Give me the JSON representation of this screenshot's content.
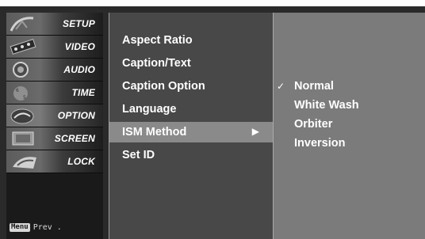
{
  "sidebar": {
    "items": [
      {
        "label": "SETUP",
        "icon": "satellite-dish-icon"
      },
      {
        "label": "VIDEO",
        "icon": "film-reel-icon"
      },
      {
        "label": "AUDIO",
        "icon": "speaker-icon"
      },
      {
        "label": "TIME",
        "icon": "clock-icon"
      },
      {
        "label": "OPTION",
        "icon": "option-icon"
      },
      {
        "label": "SCREEN",
        "icon": "screen-icon"
      },
      {
        "label": "LOCK",
        "icon": "lock-icon"
      }
    ],
    "active_item": "OPTION",
    "footer": {
      "menu_key": "Menu",
      "prev_label": "Prev ."
    }
  },
  "options": {
    "items": [
      {
        "label": "Aspect Ratio"
      },
      {
        "label": "Caption/Text"
      },
      {
        "label": "Caption Option"
      },
      {
        "label": "Language"
      },
      {
        "label": "ISM Method",
        "arrow": "▶"
      },
      {
        "label": "Set ID"
      }
    ],
    "selected": "ISM Method"
  },
  "submenu": {
    "items": [
      {
        "label": "Normal",
        "check": "✓"
      },
      {
        "label": "White Wash",
        "check": ""
      },
      {
        "label": "Orbiter",
        "check": ""
      },
      {
        "label": "Inversion",
        "check": ""
      }
    ],
    "checked": "Normal"
  },
  "colors": {
    "background": "#2a2a2a",
    "middle_panel": "#484848",
    "right_panel": "#7b7b7b",
    "highlight": "#8a8a8a"
  }
}
